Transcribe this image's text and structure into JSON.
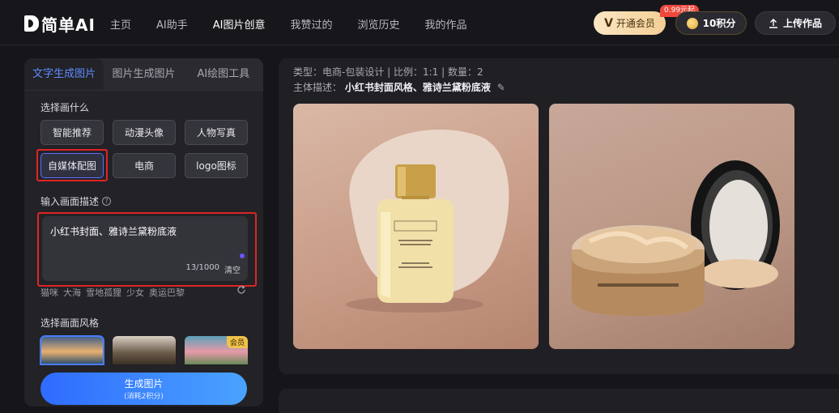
{
  "app": {
    "logo_text": "简单AI"
  },
  "nav": {
    "items": [
      {
        "label": "主页"
      },
      {
        "label": "AI助手"
      },
      {
        "label": "AI图片创意"
      },
      {
        "label": "我赞过的"
      },
      {
        "label": "浏览历史"
      },
      {
        "label": "我的作品"
      }
    ]
  },
  "header": {
    "vip_label": "开通会员",
    "vip_badge": "0.99元起",
    "points_label": "10积分",
    "upload_label": "上传作品"
  },
  "panel": {
    "tabs": [
      {
        "label": "文字生成图片"
      },
      {
        "label": "图片生成图片"
      },
      {
        "label": "AI绘图工具"
      }
    ],
    "choose_label": "选择画什么",
    "chips": [
      {
        "label": "智能推荐"
      },
      {
        "label": "动漫头像"
      },
      {
        "label": "人物写真"
      },
      {
        "label": "自媒体配图"
      },
      {
        "label": "电商"
      },
      {
        "label": "logo图标"
      }
    ],
    "desc_label": "输入画面描述",
    "desc_value": "小红书封面、雅诗兰黛粉底液",
    "counter": "13/1000",
    "clear_label": "清空",
    "suggestions": [
      "猫咪",
      "大海",
      "雪地孤狸",
      "少女",
      "奥运巴黎"
    ],
    "style_label": "选择画面风格",
    "vip_tag": "会员",
    "generate_label": "生成图片",
    "generate_sub": "(消耗2积分)"
  },
  "result": {
    "meta_line1": "类型：电商-包装设计 | 比例：1:1 | 数量：2",
    "subject_label": "主体描述：",
    "subject_value": "小红书封面风格、雅诗兰黛粉底液"
  },
  "colors": {
    "accent": "#4a7dff",
    "highlight_red": "#e02424",
    "vip_gold": "#f3cf95"
  }
}
